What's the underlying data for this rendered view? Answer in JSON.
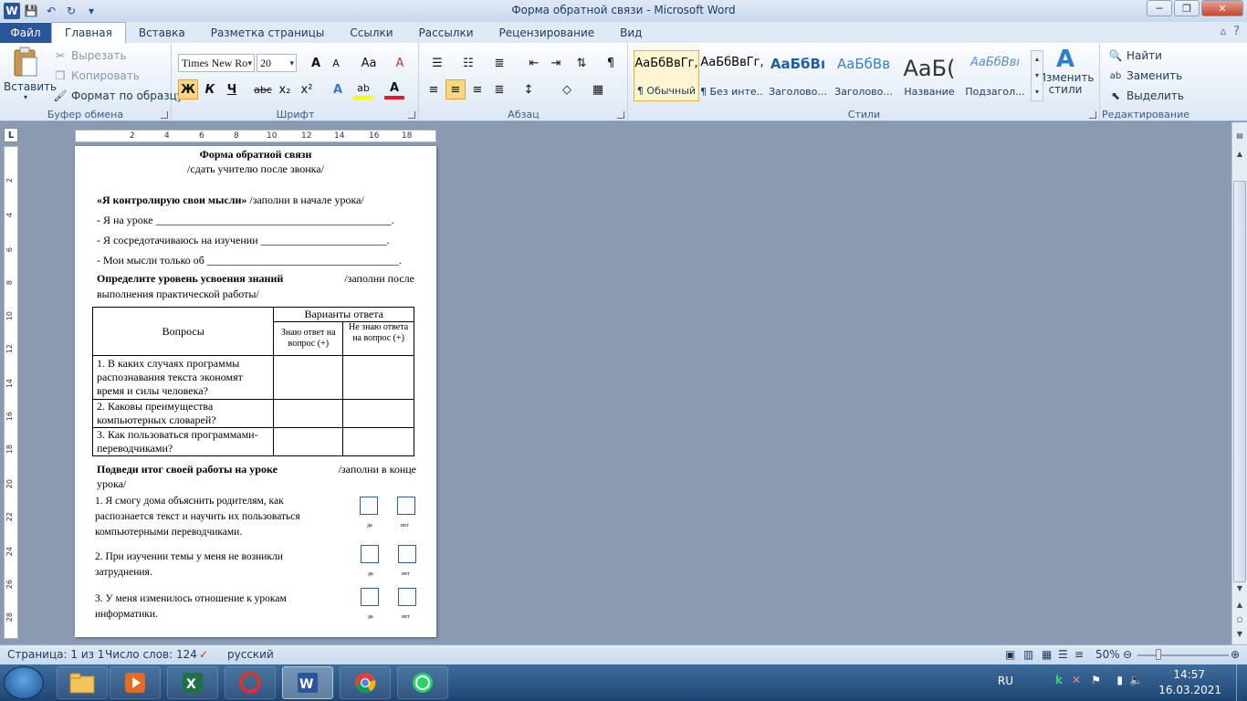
{
  "window": {
    "title": "Форма обратной связи  -  Microsoft Word",
    "controls": {
      "minimize": "─",
      "maximize": "❐",
      "close": "✕"
    }
  },
  "qat": {
    "app": "W",
    "save": "💾",
    "undo": "↶",
    "redo": "↻",
    "more": "▾"
  },
  "tabs": [
    {
      "label": "Файл"
    },
    {
      "label": "Главная"
    },
    {
      "label": "Вставка"
    },
    {
      "label": "Разметка страницы"
    },
    {
      "label": "Ссылки"
    },
    {
      "label": "Рассылки"
    },
    {
      "label": "Рецензирование"
    },
    {
      "label": "Вид"
    }
  ],
  "tabs_right": {
    "minimize": "▵",
    "help": "?"
  },
  "ribbon": {
    "clipboard": {
      "label": "Буфер обмена",
      "paste": "Вставить",
      "cut": "Вырезать",
      "copy": "Копировать",
      "format_painter": "Формат по образцу"
    },
    "font": {
      "label": "Шрифт",
      "family": "Times New Ro",
      "size": "20",
      "grow": "A",
      "shrink": "A",
      "case": "Aa",
      "clear": "A",
      "bold": "Ж",
      "italic": "К",
      "underline": "Ч",
      "strike": "abc",
      "sub": "x₂",
      "sup": "x²",
      "effects": "A",
      "highlight": "ab",
      "color": "A"
    },
    "paragraph": {
      "label": "Абзац",
      "pilcrow": "¶"
    },
    "styles": {
      "label": "Стили",
      "items": [
        {
          "sample": "АаБбВвГг,",
          "name": "¶ Обычный"
        },
        {
          "sample": "АаБбВвГг,",
          "name": "¶ Без инте..."
        },
        {
          "sample": "АаБбВı",
          "name": "Заголово..."
        },
        {
          "sample": "АаБбВв",
          "name": "Заголово..."
        },
        {
          "sample": "АаБ(",
          "name": "Название"
        },
        {
          "sample": "АаБбВвı",
          "name": "Подзагол..."
        }
      ],
      "change": "Изменить стили"
    },
    "editing": {
      "label": "Редактирование",
      "find": "Найти",
      "replace": "Заменить",
      "select": "Выделить"
    }
  },
  "ruler": {
    "corner": "L",
    "h_ticks": [
      "2",
      "4",
      "6",
      "8",
      "10",
      "12",
      "14",
      "16",
      "18"
    ],
    "v_ticks": [
      "2",
      "4",
      "6",
      "8",
      "10",
      "12",
      "14",
      "16",
      "18",
      "20",
      "22",
      "24",
      "26",
      "28"
    ]
  },
  "document": {
    "title": "Форма обратной связи",
    "subtitle": "/сдать учителю после звонка/",
    "s1_bold": "«Я контролирую свои мысли»",
    "s1_note": " /заполни в начале урока/",
    "line1": "- Я на уроке ___________________________________________.",
    "line2": "- Я сосредотачиваюсь на изучении _______________________.",
    "line3": "- Мои мысли только об ___________________________________.",
    "s2_bold": "Определите уровень усвоения знаний",
    "s2_note": " /заполни после",
    "s2_cont": "выполнения практической работы/",
    "table": {
      "col_questions": "Вопросы",
      "col_variants": "Варианты ответа",
      "col_know": "Знаю ответ на вопрос (+)",
      "col_dont": "Не знаю ответа  на вопрос (+)",
      "rows": [
        "1.  В каких случаях программы распознавания текста экономят время и силы человека?",
        "2.  Каковы преимущества компьютерных словарей?",
        "3.  Как пользоваться программами-переводчиками?"
      ]
    },
    "s3_bold": "Подведи итог своей работы на уроке",
    "s3_note": " /заполни в конце",
    "s3_cont": "урока/",
    "r1": [
      "1. Я смогу дома объяснить родителям, как",
      "распознается текст и научить их пользоваться",
      "компьютерными переводчиками."
    ],
    "r2": [
      "2. При изучении темы у меня не возникли",
      "затруднения."
    ],
    "r3": [
      "3. У меня изменилось отношение к урокам",
      "информатики."
    ],
    "yes": "да",
    "no": "нет"
  },
  "status": {
    "page": "Страница: 1 из 1",
    "words": "Число слов: 124",
    "lang": "русский",
    "zoom": "50%"
  },
  "tray": {
    "lang": "RU",
    "time": "14:57",
    "date": "16.03.2021"
  }
}
